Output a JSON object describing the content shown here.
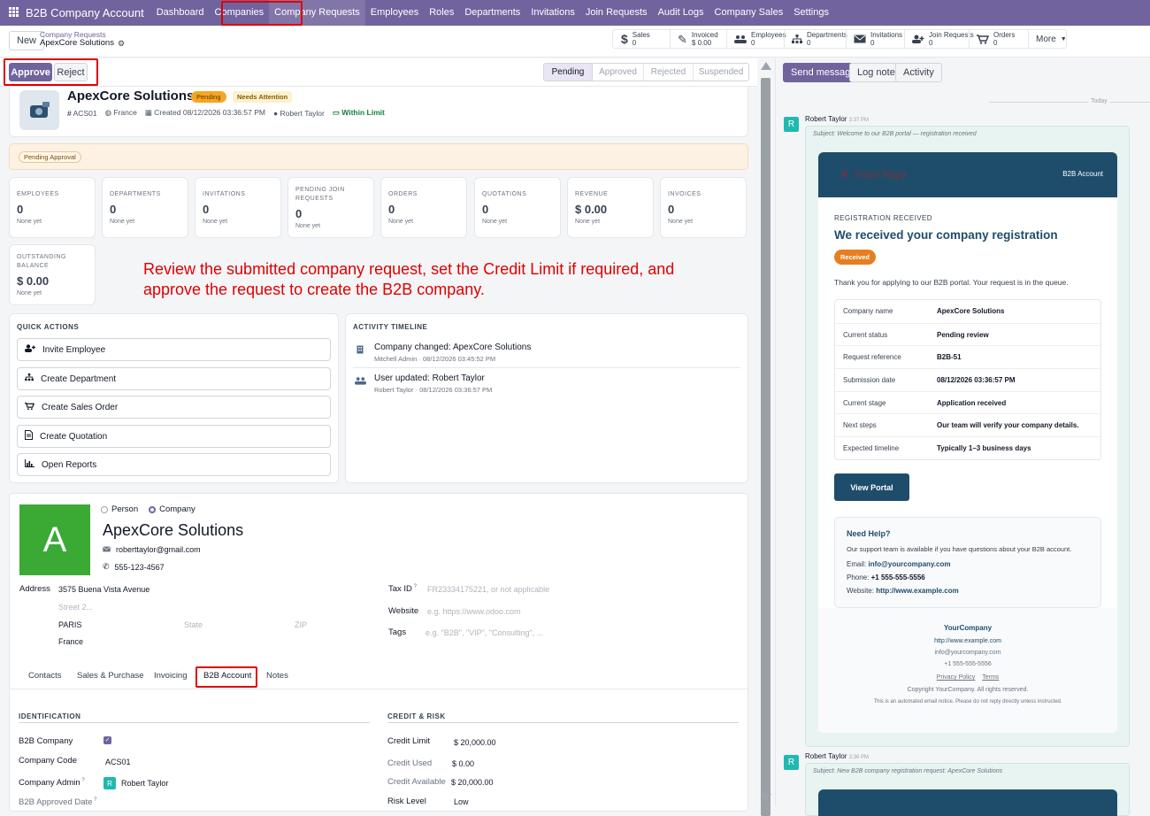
{
  "nav": {
    "app_name": "B2B Company Account",
    "items": [
      "Dashboard",
      "Companies",
      "Company Requests",
      "Employees",
      "Roles",
      "Departments",
      "Invitations",
      "Join Requests",
      "Audit Logs",
      "Company Sales",
      "Settings"
    ]
  },
  "control": {
    "new_label": "New",
    "breadcrumb_parent": "Company Requests",
    "breadcrumb_current": "ApexCore Solutions",
    "stats": [
      {
        "label": "Sales",
        "value": "0",
        "icon": "dollar-icon"
      },
      {
        "label": "Invoiced",
        "value": "$ 0.00",
        "icon": "invoice-icon"
      },
      {
        "label": "Employees",
        "value": "0",
        "icon": "users-icon"
      },
      {
        "label": "Departments",
        "value": "0",
        "icon": "sitemap-icon"
      },
      {
        "label": "Invitations",
        "value": "0",
        "icon": "envelope-icon"
      },
      {
        "label": "Join Requests",
        "value": "0",
        "icon": "user-plus-icon"
      },
      {
        "label": "Orders",
        "value": "0",
        "icon": "cart-icon"
      }
    ],
    "more_label": "More"
  },
  "status": {
    "approve": "Approve",
    "reject": "Reject",
    "stages": [
      "Pending",
      "Approved",
      "Rejected",
      "Suspended"
    ]
  },
  "header": {
    "name": "ApexCore Solutions",
    "badge_pending": "Pending",
    "badge_attention": "Needs Attention",
    "code": "ACS01",
    "country": "France",
    "created": "Created 08/12/2026 03:36:57 PM",
    "user": "Robert Taylor",
    "limit": "Within Limit",
    "pending_approval": "Pending Approval"
  },
  "kpis": [
    {
      "label": "EMPLOYEES",
      "value": "0",
      "sub": "None yet"
    },
    {
      "label": "DEPARTMENTS",
      "value": "0",
      "sub": "None yet"
    },
    {
      "label": "INVITATIONS",
      "value": "0",
      "sub": "None yet"
    },
    {
      "label": "PENDING JOIN REQUESTS",
      "value": "0",
      "sub": "None yet"
    },
    {
      "label": "ORDERS",
      "value": "0",
      "sub": "None yet"
    },
    {
      "label": "QUOTATIONS",
      "value": "0",
      "sub": "None yet"
    },
    {
      "label": "REVENUE",
      "value": "$ 0.00",
      "sub": "None yet"
    },
    {
      "label": "INVOICES",
      "value": "0",
      "sub": "None yet"
    },
    {
      "label": "OUTSTANDING BALANCE",
      "value": "$ 0.00",
      "sub": "None yet"
    }
  ],
  "instruction": "Review the submitted company request, set the Credit Limit if required, and approve the request to create the B2B company.",
  "quick_actions": {
    "title": "QUICK ACTIONS",
    "items": [
      "Invite Employee",
      "Create Department",
      "Create Sales Order",
      "Create Quotation",
      "Open Reports"
    ]
  },
  "timeline": {
    "title": "ACTIVITY TIMELINE",
    "items": [
      {
        "title": "Company changed: ApexCore Solutions",
        "meta": "Mitchell Admin · 08/12/2026 03:45:52 PM"
      },
      {
        "title": "User updated: Robert Taylor",
        "meta": "Robert Taylor · 08/12/2026 03:36:57 PM"
      }
    ]
  },
  "form": {
    "avatar_letter": "A",
    "type_person": "Person",
    "type_company": "Company",
    "name": "ApexCore Solutions",
    "email": "roberttaylor@gmail.com",
    "phone": "555-123-4567",
    "address_label": "Address",
    "street": "3575 Buena Vista Avenue",
    "street2_ph": "Street 2...",
    "city": "PARIS",
    "state_ph": "State",
    "zip_ph": "ZIP",
    "country": "France",
    "taxid_label": "Tax ID",
    "taxid_ph": "FR23334175221, or not applicable",
    "website_label": "Website",
    "website_ph": "e.g. https://www.odoo.com",
    "tags_label": "Tags",
    "tags_ph": "e.g. \"B2B\", \"VIP\", \"Consulting\", ...",
    "tabs": [
      "Contacts",
      "Sales & Purchase",
      "Invoicing",
      "B2B Account",
      "Notes"
    ],
    "identification_title": "IDENTIFICATION",
    "credit_title": "CREDIT & RISK",
    "b2b_company_label": "B2B Company",
    "company_code_label": "Company Code",
    "company_code": "ACS01",
    "company_admin_label": "Company Admin",
    "company_admin": "Robert Taylor",
    "approved_date_label": "B2B Approved Date",
    "credit_limit_label": "Credit Limit",
    "credit_limit": "$ 20,000.00",
    "credit_used_label": "Credit Used",
    "credit_used": "$ 0.00",
    "credit_available_label": "Credit Available",
    "credit_available": "$ 20,000.00",
    "risk_label": "Risk Level",
    "risk": "Low"
  },
  "chatter": {
    "send_message": "Send message",
    "log_note": "Log note",
    "activity": "Activity",
    "today": "Today",
    "msg1_author": "Robert Taylor",
    "msg1_time": "3:37 PM",
    "msg1_subject": "Subject: Welcome to our B2B portal — registration received",
    "logo_text": "Your logo",
    "header_right": "B2B Account",
    "eyebrow": "REGISTRATION RECEIVED",
    "headline": "We received your company registration",
    "received_pill": "Received",
    "intro": "Thank you for applying to our B2B portal. Your request is in the queue.",
    "rows": [
      {
        "k": "Company name",
        "v": "ApexCore Solutions"
      },
      {
        "k": "Current status",
        "v": "Pending review"
      },
      {
        "k": "Request reference",
        "v": "B2B-51"
      },
      {
        "k": "Submission date",
        "v": "08/12/2026 03:36:57 PM"
      },
      {
        "k": "Current stage",
        "v": "Application received"
      },
      {
        "k": "Next steps",
        "v": "Our team will verify your company details."
      },
      {
        "k": "Expected timeline",
        "v": "Typically 1–3 business days"
      }
    ],
    "view_portal": "View Portal",
    "help_title": "Need Help?",
    "help_text": "Our support team is available if you have questions about your B2B account.",
    "help_email_label": "Email:",
    "help_email": "info@yourcompany.com",
    "help_phone_label": "Phone:",
    "help_phone": "+1 555-555-5556",
    "help_web_label": "Website:",
    "help_web": "http://www.example.com",
    "footer_company": "YourCompany",
    "footer_web": "http://www.example.com",
    "footer_email": "info@yourcompany.com",
    "footer_phone": "+1 555-555-5556",
    "privacy": "Privacy Policy",
    "terms": "Terms",
    "copyright": "Copyright YourCompany. All rights reserved.",
    "notice": "This is an automated email notice. Please do not reply directly unless instructed.",
    "msg2_author": "Robert Taylor",
    "msg2_time": "3:36 PM",
    "msg2_subject": "Subject: New B2B company registration request: ApexCore Solutions"
  },
  "colors": {
    "nav": "#71639e",
    "accent": "#71639e",
    "mail_header": "#1e4d6b",
    "green": "#3aaa35",
    "pending": "#f5a623",
    "red": "#e00000"
  }
}
